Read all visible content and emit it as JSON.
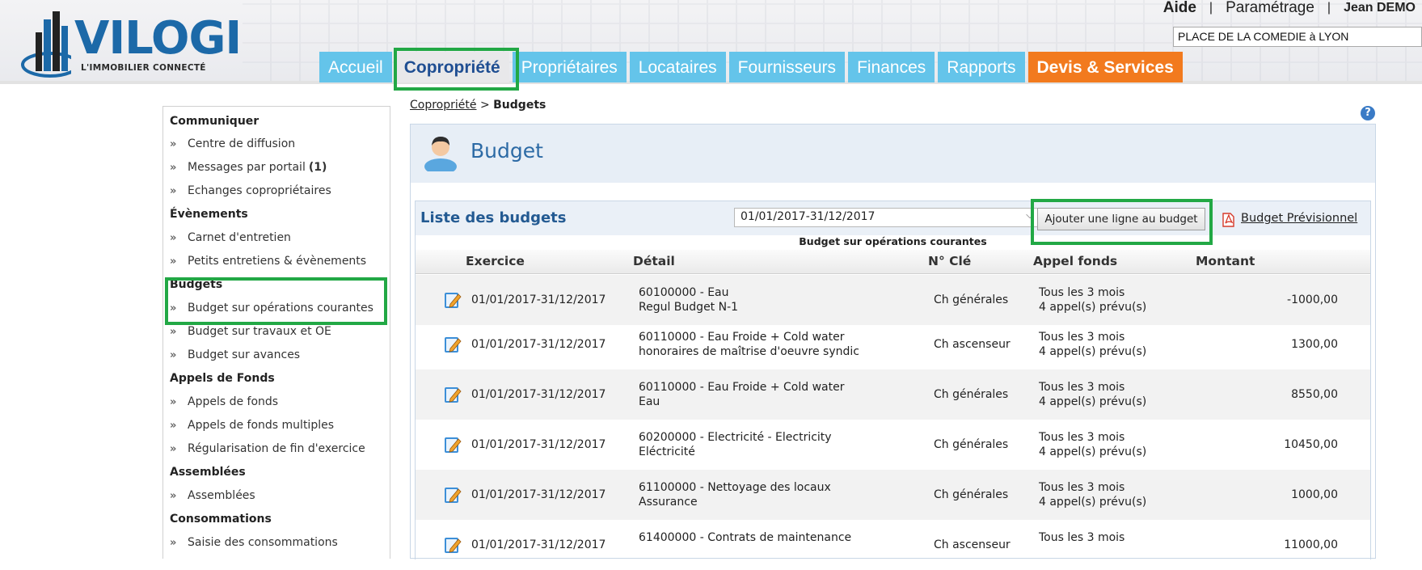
{
  "brand": {
    "name": "VILOGI",
    "tagline": "L'IMMOBILIER CONNECTÉ"
  },
  "top_links": {
    "help": "Aide",
    "separator": "|",
    "settings": "Paramétrage",
    "user": "Jean DEMO"
  },
  "site_select": {
    "value": "PLACE DE LA COMEDIE à LYON"
  },
  "nav": {
    "tabs": [
      {
        "label": "Accueil"
      },
      {
        "label": "Copropriété"
      },
      {
        "label": "Propriétaires"
      },
      {
        "label": "Locataires"
      },
      {
        "label": "Fournisseurs"
      },
      {
        "label": "Finances"
      },
      {
        "label": "Rapports"
      },
      {
        "label": "Devis & Services"
      }
    ],
    "active_index": 1
  },
  "sidebar": {
    "sections": [
      {
        "title": "Communiquer",
        "items": [
          {
            "label": "Centre de diffusion"
          },
          {
            "label": "Messages par portail",
            "count": "(1)"
          },
          {
            "label": "Echanges copropriétaires"
          }
        ]
      },
      {
        "title": "Évènements",
        "items": [
          {
            "label": "Carnet d'entretien"
          },
          {
            "label": "Petits entretiens & évènements"
          }
        ]
      },
      {
        "title": "Budgets",
        "items": [
          {
            "label": "Budget sur opérations courantes"
          },
          {
            "label": "Budget sur travaux et OE"
          },
          {
            "label": "Budget sur avances"
          }
        ]
      },
      {
        "title": "Appels de Fonds",
        "items": [
          {
            "label": "Appels de fonds"
          },
          {
            "label": "Appels de fonds multiples"
          },
          {
            "label": "Régularisation de fin d'exercice"
          }
        ]
      },
      {
        "title": "Assemblées",
        "items": [
          {
            "label": "Assemblées"
          }
        ]
      },
      {
        "title": "Consommations",
        "items": [
          {
            "label": "Saisie des consommations"
          }
        ]
      }
    ]
  },
  "breadcrumb": {
    "parent": "Copropriété",
    "separator": ">",
    "current": "Budgets"
  },
  "help_icon": "?",
  "panel": {
    "title": "Budget"
  },
  "list": {
    "title": "Liste des budgets",
    "period": "01/01/2017-31/12/2017",
    "add_button": "Ajouter une ligne au budget",
    "forecast_link": "Budget Prévisionnel",
    "subtitle": "Budget sur opérations courantes",
    "columns": [
      "Exercice",
      "Détail",
      "N° Clé",
      "Appel fonds",
      "Montant"
    ],
    "rows": [
      {
        "exercice": "01/01/2017-31/12/2017",
        "detail_1": "60100000 - Eau",
        "detail_2": "Regul Budget N-1",
        "cle": "Ch générales",
        "appel_1": "Tous les 3 mois",
        "appel_2": "4 appel(s) prévu(s)",
        "montant": "-1000,00"
      },
      {
        "exercice": "01/01/2017-31/12/2017",
        "detail_1": "60110000 - Eau Froide + Cold water",
        "detail_2": "honoraires de maîtrise d'oeuvre syndic",
        "cle": "Ch ascenseur",
        "appel_1": "Tous les 3 mois",
        "appel_2": "4 appel(s) prévu(s)",
        "montant": "1300,00"
      },
      {
        "exercice": "01/01/2017-31/12/2017",
        "detail_1": "60110000 - Eau Froide + Cold water",
        "detail_2": "Eau",
        "cle": "Ch générales",
        "appel_1": "Tous les 3 mois",
        "appel_2": "4 appel(s) prévu(s)",
        "montant": "8550,00"
      },
      {
        "exercice": "01/01/2017-31/12/2017",
        "detail_1": "60200000 - Electricité - Electricity",
        "detail_2": "Eléctricité",
        "cle": "Ch générales",
        "appel_1": "Tous les 3 mois",
        "appel_2": "4 appel(s) prévu(s)",
        "montant": "10450,00"
      },
      {
        "exercice": "01/01/2017-31/12/2017",
        "detail_1": "61100000 - Nettoyage des locaux",
        "detail_2": "Assurance",
        "cle": "Ch générales",
        "appel_1": "Tous les 3 mois",
        "appel_2": "4 appel(s) prévu(s)",
        "montant": "1000,00"
      },
      {
        "exercice": "01/01/2017-31/12/2017",
        "detail_1": "61400000 - Contrats de maintenance",
        "detail_2": "",
        "cle": "Ch ascenseur",
        "appel_1": "Tous les 3 mois",
        "appel_2": "",
        "montant": "11000,00"
      }
    ]
  },
  "colors": {
    "tab_blue": "#64c4ea",
    "tab_orange": "#f27a1e",
    "highlight_green": "#22a845",
    "title_blue": "#2c6aa5"
  }
}
